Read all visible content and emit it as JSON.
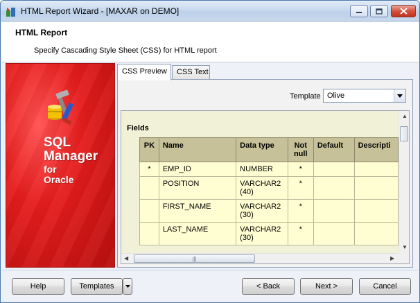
{
  "window": {
    "title": "HTML Report Wizard - [MAXAR on DEMO]",
    "icon": "wizard-app-icon"
  },
  "header": {
    "title": "HTML Report",
    "subtitle": "Specify Cascading Style Sheet (CSS) for HTML report"
  },
  "banner": {
    "line1": "SQL",
    "line2": "Manager",
    "line3": "for",
    "line4": "Oracle",
    "icon": "sql-manager-logo-icon"
  },
  "tabs": [
    {
      "label": "CSS Preview",
      "active": true
    },
    {
      "label": "CSS Text",
      "active": false
    }
  ],
  "template": {
    "label": "Template",
    "value": "Olive"
  },
  "preview": {
    "section_title": "Fields",
    "columns": [
      "PK",
      "Name",
      "Data type",
      "Not null",
      "Default",
      "Descripti"
    ],
    "rows": [
      {
        "pk": "*",
        "name": "EMP_ID",
        "type": "NUMBER",
        "notnull": "*",
        "default": "",
        "desc": ""
      },
      {
        "pk": "",
        "name": "POSITION",
        "type": "VARCHAR2 (40)",
        "notnull": "*",
        "default": "",
        "desc": ""
      },
      {
        "pk": "",
        "name": "FIRST_NAME",
        "type": "VARCHAR2 (30)",
        "notnull": "*",
        "default": "",
        "desc": ""
      },
      {
        "pk": "",
        "name": "LAST_NAME",
        "type": "VARCHAR2 (30)",
        "notnull": "*",
        "default": "",
        "desc": ""
      }
    ]
  },
  "buttons": {
    "help": "Help",
    "templates": "Templates",
    "back": "< Back",
    "next": "Next >",
    "cancel": "Cancel"
  },
  "colors": {
    "table_header": "#c6c198",
    "table_cell": "#fffed2",
    "preview_bg": "#f1f1d8",
    "banner_red": "#e51d1d"
  }
}
